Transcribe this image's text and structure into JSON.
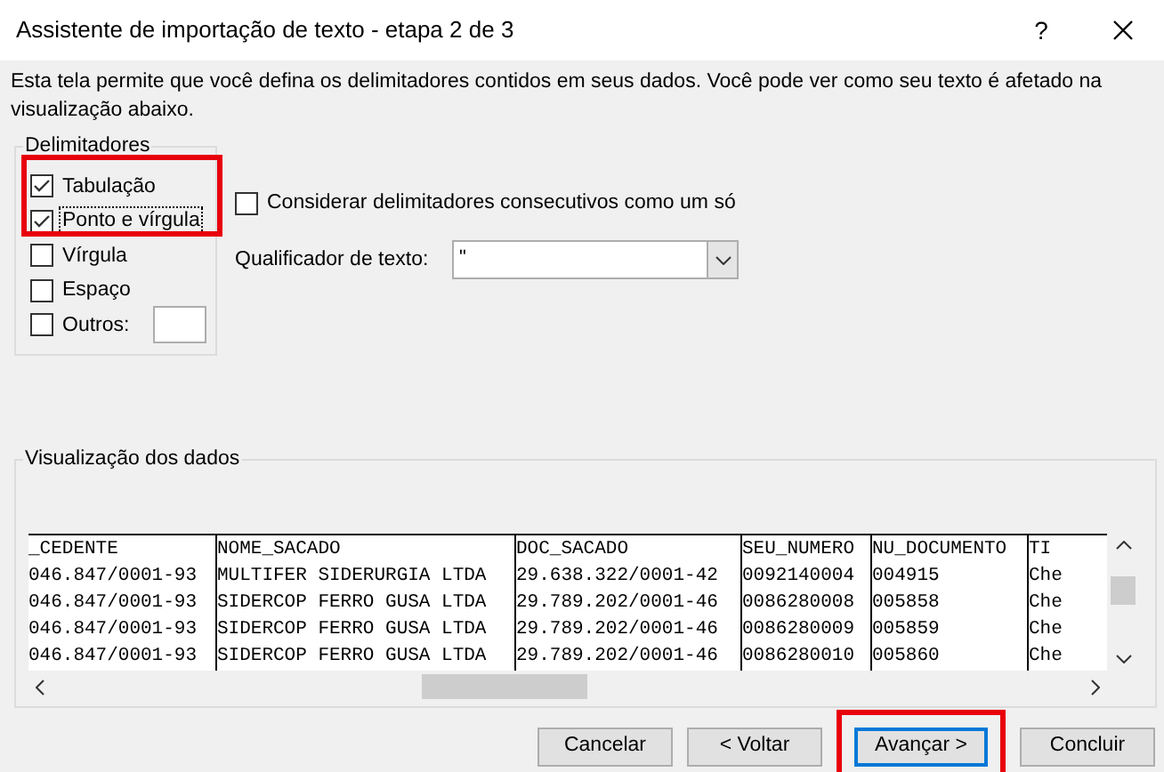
{
  "window": {
    "title": "Assistente de importação de texto - etapa 2 de 3",
    "help": "?"
  },
  "description": "Esta tela permite que você defina os delimitadores contidos em seus dados. Você pode ver como seu texto é afetado na visualização abaixo.",
  "delimiters": {
    "title": "Delimitadores",
    "items": [
      {
        "label": "Tabulação",
        "checked": true,
        "highlighted": true
      },
      {
        "label": "Ponto e vírgula",
        "checked": true,
        "highlighted": true,
        "focused": true
      },
      {
        "label": "Vírgula",
        "checked": false,
        "highlighted": false
      },
      {
        "label": "Espaço",
        "checked": false,
        "highlighted": false
      },
      {
        "label": "Outros:",
        "checked": false,
        "highlighted": false,
        "has_field": true
      }
    ]
  },
  "consecutive": {
    "label": "Considerar delimitadores consecutivos como um só",
    "checked": false
  },
  "qualifier": {
    "label": "Qualificador de texto:",
    "value": "\""
  },
  "preview": {
    "title": "Visualização dos dados",
    "columns": [
      "_CEDENTE",
      "NOME_SACADO",
      "DOC_SACADO",
      "SEU_NUMERO",
      "NU_DOCUMENTO",
      "TI"
    ],
    "rows": [
      [
        "046.847/0001-93",
        "MULTIFER SIDERURGIA LTDA",
        "29.638.322/0001-42",
        "0092140004",
        "004915",
        "Che"
      ],
      [
        "046.847/0001-93",
        "SIDERCOP FERRO GUSA LTDA",
        "29.789.202/0001-46",
        "0086280008",
        "005858",
        "Che"
      ],
      [
        "046.847/0001-93",
        "SIDERCOP FERRO GUSA LTDA",
        "29.789.202/0001-46",
        "0086280009",
        "005859",
        "Che"
      ],
      [
        "046.847/0001-93",
        "SIDERCOP FERRO GUSA LTDA",
        "29.789.202/0001-46",
        "0086280010",
        "005860",
        "Che"
      ]
    ]
  },
  "buttons": [
    {
      "label": "Cancelar",
      "default": false,
      "highlighted": false
    },
    {
      "label": "< Voltar",
      "default": false,
      "highlighted": false
    },
    {
      "label": "Avançar >",
      "default": true,
      "highlighted": true
    },
    {
      "label": "Concluir",
      "default": false,
      "highlighted": false
    }
  ]
}
